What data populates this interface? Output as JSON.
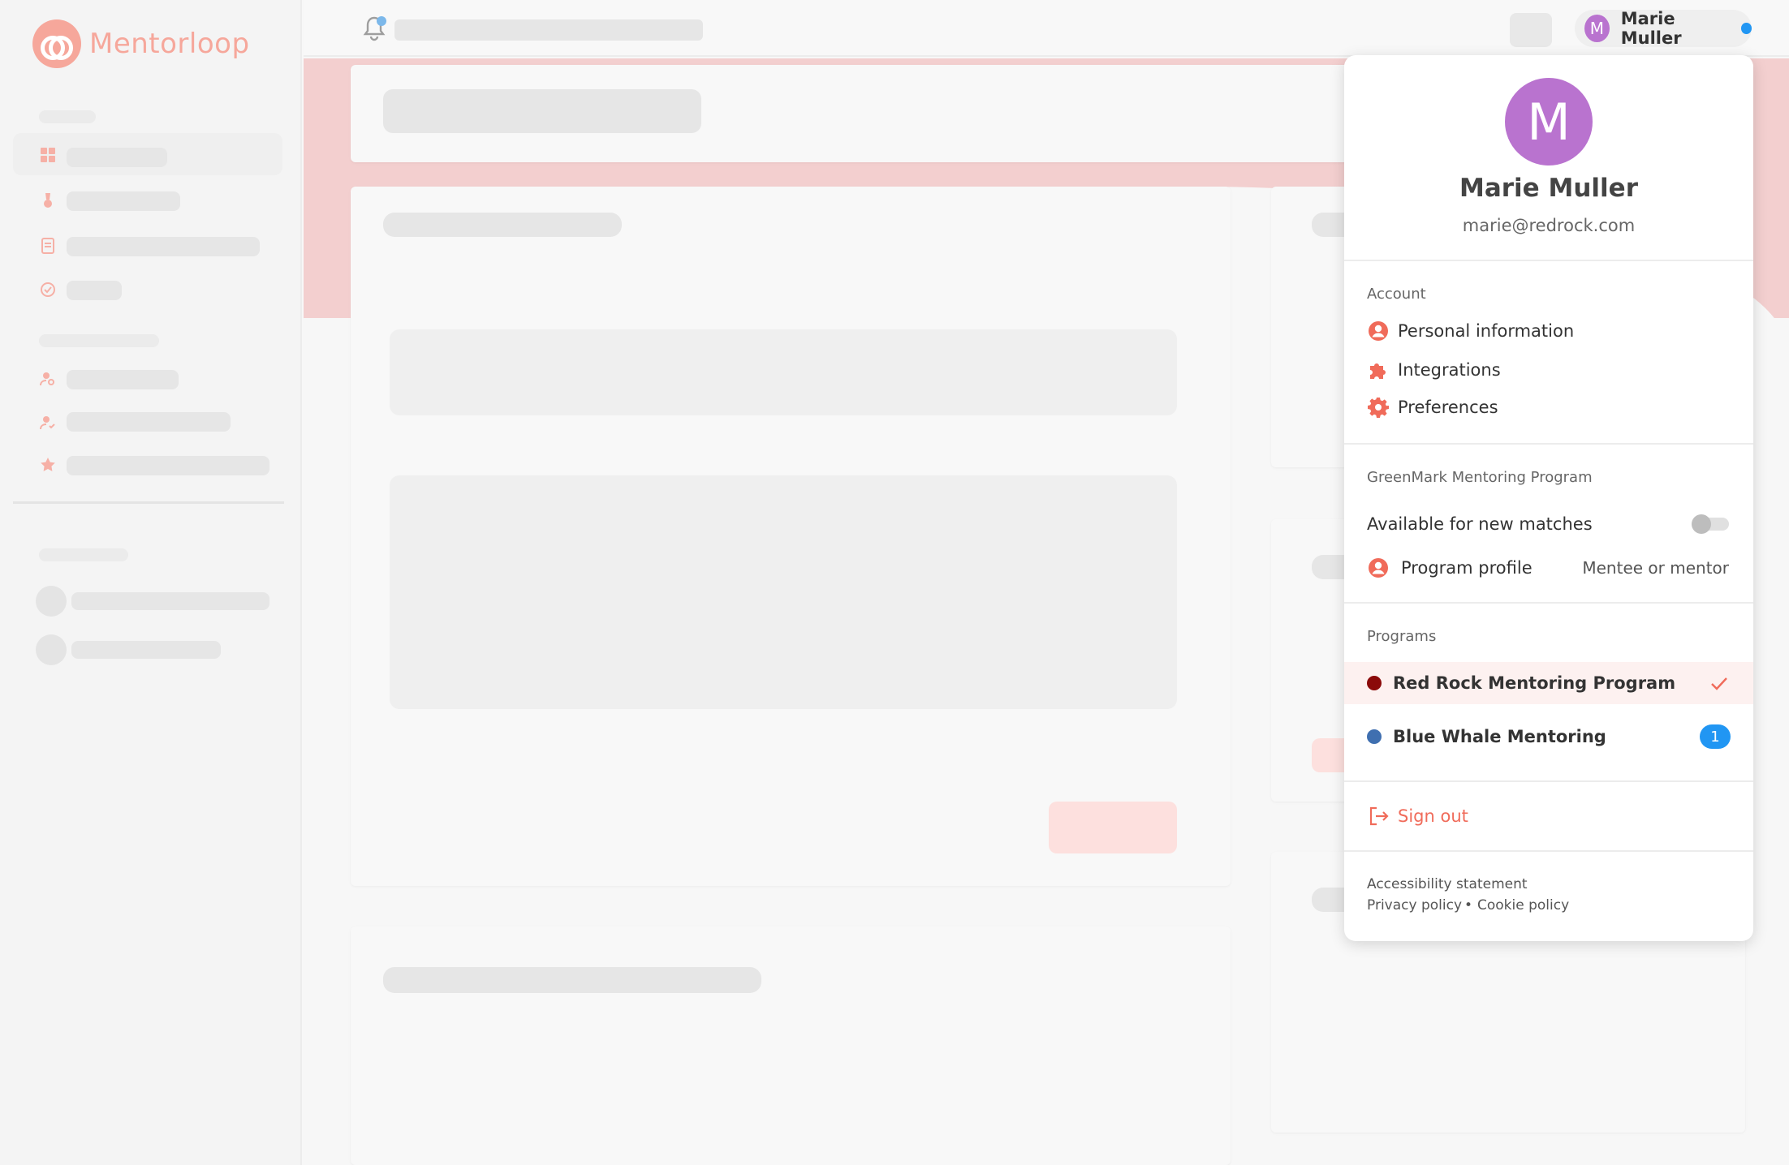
{
  "app": {
    "logo_text": "Mentorloop",
    "brand_color": "#f6a79b",
    "accent_color": "#f06b5a"
  },
  "topbar": {
    "user_name": "Marie Muller",
    "avatar_initial": "M",
    "status_color": "#2196f3"
  },
  "profile": {
    "avatar_initial": "M",
    "name": "Marie Muller",
    "email": "marie@redrock.com",
    "avatar_color": "#b973cf"
  },
  "account": {
    "label": "Account",
    "items": [
      {
        "label": "Personal information",
        "icon": "user-circle-icon"
      },
      {
        "label": "Integrations",
        "icon": "puzzle-icon"
      },
      {
        "label": "Preferences",
        "icon": "gear-icon"
      }
    ]
  },
  "current_program": {
    "label": "GreenMark Mentoring Program",
    "availability_label": "Available for new matches",
    "availability_on": false,
    "profile_label": "Program profile",
    "profile_role": "Mentee or mentor"
  },
  "programs": {
    "label": "Programs",
    "items": [
      {
        "label": "Red Rock Mentoring Program",
        "color": "#8b0a0a",
        "selected": true
      },
      {
        "label": "Blue Whale Mentoring",
        "color": "#3f6fb0",
        "badge": "1"
      }
    ]
  },
  "sign_out": {
    "label": "Sign out"
  },
  "footer": {
    "accessibility": "Accessibility statement",
    "privacy": "Privacy policy",
    "separator": "•",
    "cookie": "Cookie policy"
  }
}
